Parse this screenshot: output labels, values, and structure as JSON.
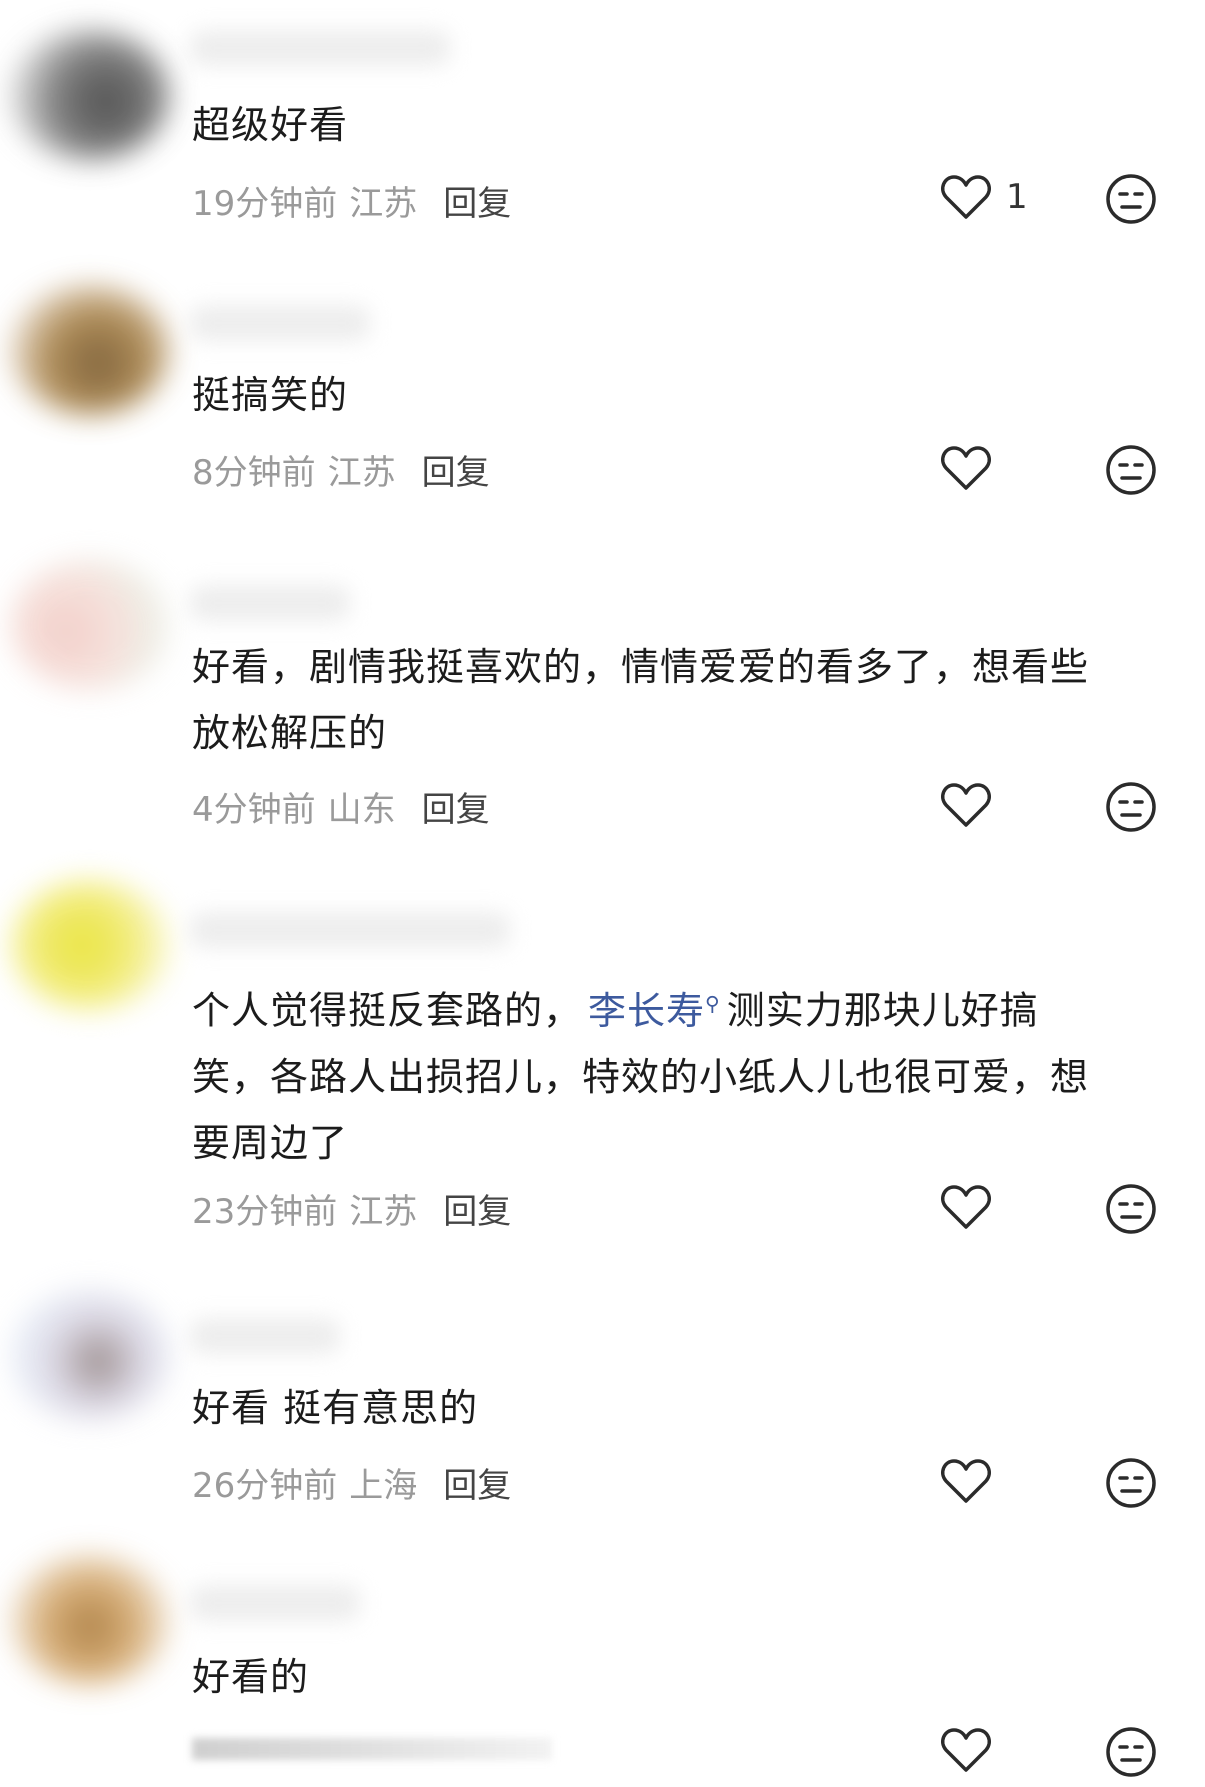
{
  "comments": [
    {
      "text": "超级好看",
      "time": "19分钟前",
      "location": "江苏",
      "reply": "回复",
      "likes": "1"
    },
    {
      "text": "挺搞笑的",
      "time": "8分钟前",
      "location": "江苏",
      "reply": "回复",
      "likes": ""
    },
    {
      "text_line1": "好看，剧情我挺喜欢的，情情爱爱的看多了，想看些",
      "text_line2": "放松解压的",
      "time": "4分钟前",
      "location": "山东",
      "reply": "回复",
      "likes": ""
    },
    {
      "text_part1": "个人觉得挺反套路的，",
      "mention": "李长寿",
      "text_part2": "测实力那块儿好搞",
      "text_line2": "笑，各路人出损招儿，特效的小纸人儿也很可爱，想",
      "text_line3": "要周边了",
      "time": "23分钟前",
      "location": "江苏",
      "reply": "回复",
      "likes": ""
    },
    {
      "text": "好看 挺有意思的",
      "time": "26分钟前",
      "location": "上海",
      "reply": "回复",
      "likes": ""
    },
    {
      "text": "好看的",
      "likes": ""
    }
  ],
  "icons": {
    "like": "heart-outline-icon",
    "dislike": "neutral-face-icon",
    "mention_search": "search-icon"
  },
  "colors": {
    "mention": "#3d5a9e",
    "meta": "#9a9a9a",
    "text": "#1c1c1c"
  }
}
